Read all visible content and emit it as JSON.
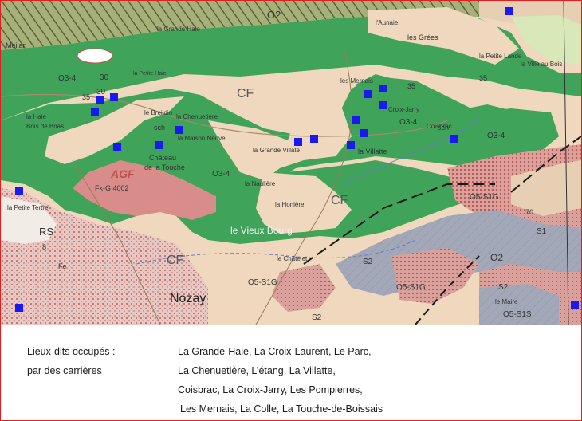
{
  "map": {
    "labels": {
      "meilan": "Meilan",
      "grande_haie_top": "la Grande Haie",
      "o2_top": "O2",
      "o34_left": "O3-4",
      "n30_a": "30",
      "n30_b": "30",
      "petite_haie": "la Petite Haie",
      "haie": "la Haie",
      "bois_de_brias": "Bois de Brias",
      "n35_left": "35",
      "n35_top": "35",
      "cf_center_top": "CF",
      "breildin": "le Breildin",
      "chenuetiere": "la Chenuetière",
      "maison_neuve": "la Maison Neuve",
      "sch_1": "sch",
      "sch_2": "sch",
      "chateau": "Château",
      "touche": "de la Touche",
      "agf": "AGF",
      "fk": "Fk-G 4002",
      "o34_center": "O3-4",
      "nauliere": "la Naulière",
      "grande_villate": "la Grande Villate",
      "les_mernais": "les Mernais",
      "croix_jarry": "Croix-Jarry",
      "villatte": "la Villatte",
      "o34_right": "O3-4",
      "o34_far": "O3-4",
      "coisbrac": "Coisbrac",
      "les_grees": "les Grées",
      "aunaie": "l'Aunaie",
      "petite_lande": "la Petite Lande",
      "ville_au_bois": "la Ville au Bois",
      "n35_right": "35",
      "cf_center": "CF",
      "honiere": "la Honière",
      "vieux_bourg": "le Vieux Bourg",
      "cf_lower": "CF",
      "o5_s1g": "O5-S1G",
      "o5_s1g_b": "O5-S1G",
      "o5_s1g_c": "O5-S1G",
      "o5_s1s": "O5-S1S",
      "s2": "S2",
      "s2_b": "S2",
      "s2_c": "S2",
      "s1": "S1",
      "o_2": "O2",
      "n70": "70",
      "chatelet": "le Châtelet",
      "le_maire": "le Maire",
      "nozay": "Nozay",
      "petite_tertre": "la Petite Tertre",
      "rs": "RS",
      "fe": "Fe",
      "n8": "8"
    },
    "colors": {
      "green": "#3fa45a",
      "dark_green": "#2f8a46",
      "beige": "#efd8bd",
      "pink_red": "#d98d8a",
      "grey_blue": "#9ea3b5",
      "pink_dotted": "#e8c3c0",
      "site_marker": "#1919f0",
      "border": "#e02020"
    },
    "marker_count": 19
  },
  "legend": {
    "left_line1": "Lieux-dits occupés :",
    "left_line2": "par des carrières",
    "right_line1": "La Grande-Haie, La Croix-Laurent, Le Parc,",
    "right_line2": "La Chenuetière, L’étang, La Villatte,",
    "right_line3": "Coisbrac, La Croix-Jarry, Les Pompierres,",
    "right_line4": "Les Mernais, La Colle, La Touche-de-Boissais"
  }
}
